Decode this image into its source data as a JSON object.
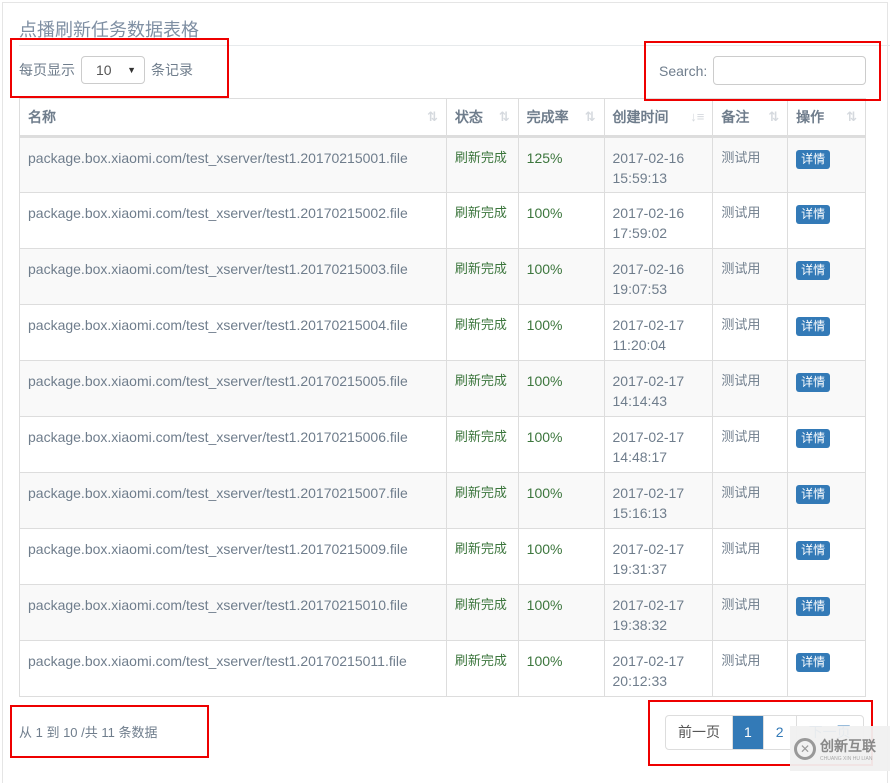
{
  "title": "点播刷新任务数据表格",
  "length": {
    "prefix": "每页显示",
    "value": "10",
    "suffix": "条记录"
  },
  "search": {
    "label": "Search:",
    "value": ""
  },
  "columns": [
    "名称",
    "状态",
    "完成率",
    "创建时间",
    "备注",
    "操作"
  ],
  "rows": [
    {
      "name": "package.box.xiaomi.com/test_xserver/test1.20170215001.file",
      "status": "刷新完成",
      "rate": "125%",
      "date": "2017-02-16",
      "time": "15:59:13",
      "note": "测试用",
      "action": "详情"
    },
    {
      "name": "package.box.xiaomi.com/test_xserver/test1.20170215002.file",
      "status": "刷新完成",
      "rate": "100%",
      "date": "2017-02-16",
      "time": "17:59:02",
      "note": "测试用",
      "action": "详情"
    },
    {
      "name": "package.box.xiaomi.com/test_xserver/test1.20170215003.file",
      "status": "刷新完成",
      "rate": "100%",
      "date": "2017-02-16",
      "time": "19:07:53",
      "note": "测试用",
      "action": "详情"
    },
    {
      "name": "package.box.xiaomi.com/test_xserver/test1.20170215004.file",
      "status": "刷新完成",
      "rate": "100%",
      "date": "2017-02-17",
      "time": "11:20:04",
      "note": "测试用",
      "action": "详情"
    },
    {
      "name": "package.box.xiaomi.com/test_xserver/test1.20170215005.file",
      "status": "刷新完成",
      "rate": "100%",
      "date": "2017-02-17",
      "time": "14:14:43",
      "note": "测试用",
      "action": "详情"
    },
    {
      "name": "package.box.xiaomi.com/test_xserver/test1.20170215006.file",
      "status": "刷新完成",
      "rate": "100%",
      "date": "2017-02-17",
      "time": "14:48:17",
      "note": "测试用",
      "action": "详情"
    },
    {
      "name": "package.box.xiaomi.com/test_xserver/test1.20170215007.file",
      "status": "刷新完成",
      "rate": "100%",
      "date": "2017-02-17",
      "time": "15:16:13",
      "note": "测试用",
      "action": "详情"
    },
    {
      "name": "package.box.xiaomi.com/test_xserver/test1.20170215009.file",
      "status": "刷新完成",
      "rate": "100%",
      "date": "2017-02-17",
      "time": "19:31:37",
      "note": "测试用",
      "action": "详情"
    },
    {
      "name": "package.box.xiaomi.com/test_xserver/test1.20170215010.file",
      "status": "刷新完成",
      "rate": "100%",
      "date": "2017-02-17",
      "time": "19:38:32",
      "note": "测试用",
      "action": "详情"
    },
    {
      "name": "package.box.xiaomi.com/test_xserver/test1.20170215011.file",
      "status": "刷新完成",
      "rate": "100%",
      "date": "2017-02-17",
      "time": "20:12:33",
      "note": "测试用",
      "action": "详情"
    }
  ],
  "info": "从 1 到 10 /共 11 条数据",
  "pager": {
    "prev": "前一页",
    "pages": [
      "1",
      "2"
    ],
    "next": "下一页"
  },
  "watermark": {
    "name": "创新互联",
    "sub": "CHUANG XIN HU LIAN"
  }
}
